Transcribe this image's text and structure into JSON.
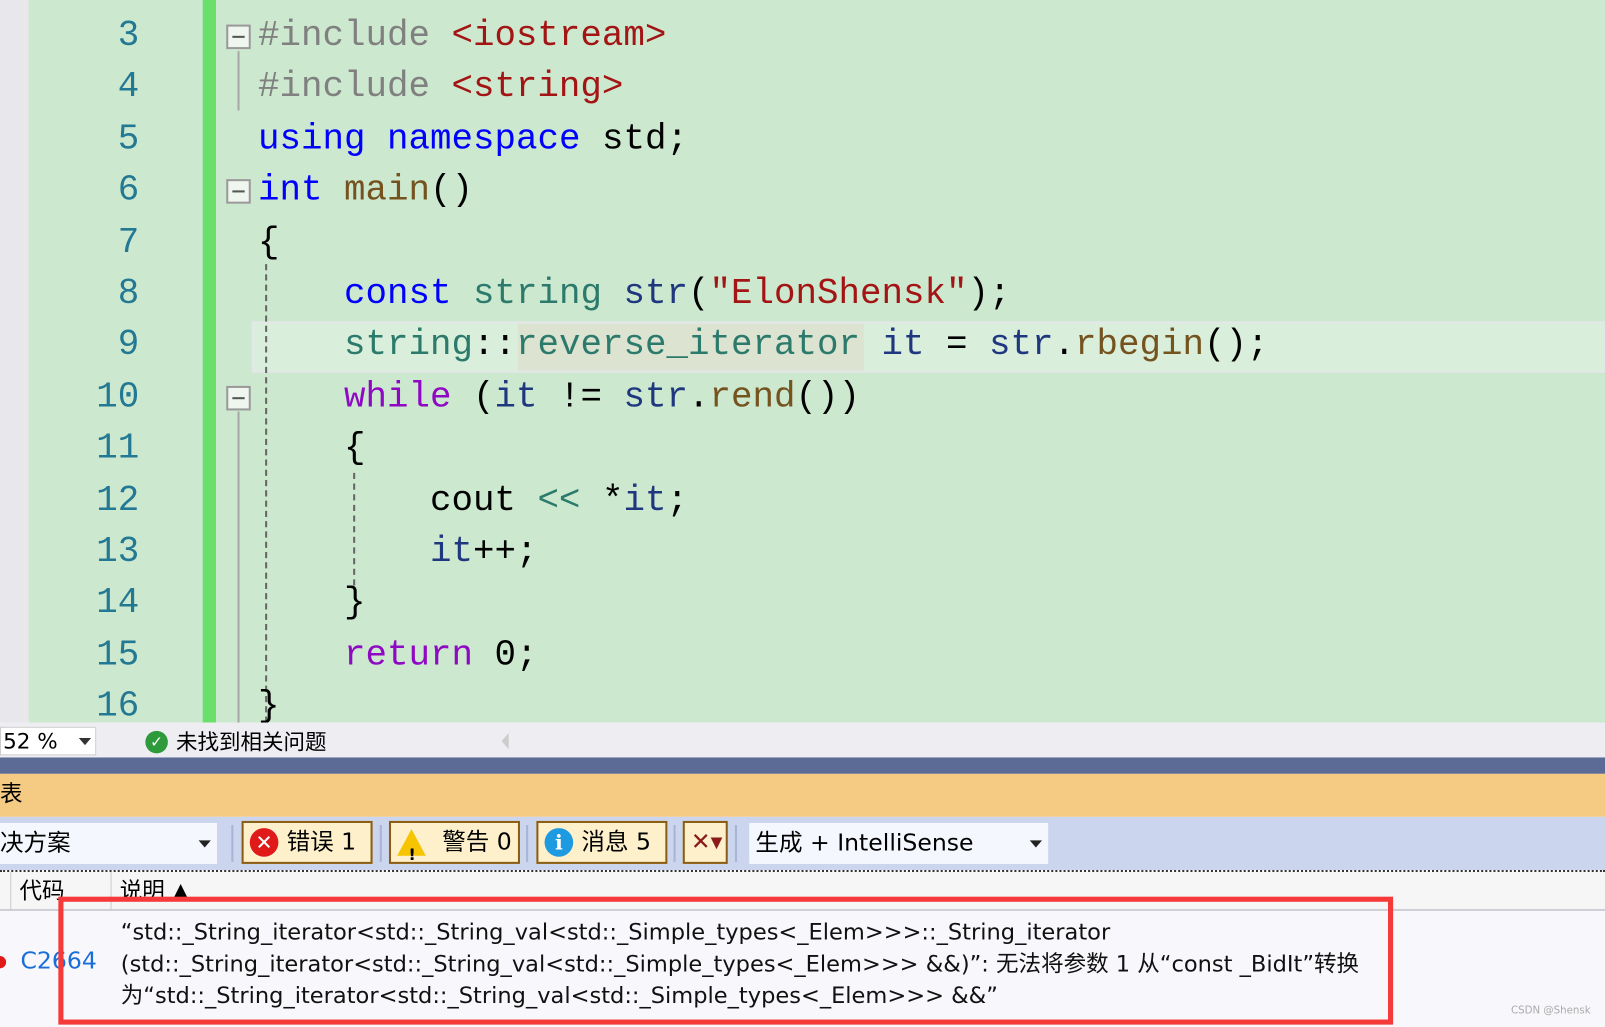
{
  "editor": {
    "lines": [
      {
        "num": "3",
        "tokens": [
          [
            "#include ",
            "pp"
          ],
          [
            "<iostream>",
            "str"
          ]
        ]
      },
      {
        "num": "4",
        "tokens": [
          [
            "#include ",
            "pp"
          ],
          [
            "<string>",
            "str"
          ]
        ]
      },
      {
        "num": "5",
        "tokens": [
          [
            "using",
            "kw"
          ],
          [
            " ",
            "plain"
          ],
          [
            "namespace",
            "kw"
          ],
          [
            " std;",
            "plain"
          ]
        ]
      },
      {
        "num": "6",
        "tokens": [
          [
            "int",
            "kw"
          ],
          [
            " ",
            "plain"
          ],
          [
            "main",
            "fn"
          ],
          [
            "()",
            "plain"
          ]
        ]
      },
      {
        "num": "7",
        "tokens": [
          [
            "{",
            "plain"
          ]
        ]
      },
      {
        "num": "8",
        "tokens": [
          [
            "    ",
            "plain"
          ],
          [
            "const",
            "kw"
          ],
          [
            " ",
            "plain"
          ],
          [
            "string",
            "ty"
          ],
          [
            " ",
            "plain"
          ],
          [
            "str",
            "var"
          ],
          [
            "(",
            "plain"
          ],
          [
            "\"ElonShensk\"",
            "str"
          ],
          [
            ");",
            "plain"
          ]
        ]
      },
      {
        "num": "9",
        "tokens": [
          [
            "    ",
            "plain"
          ],
          [
            "string",
            "ty"
          ],
          [
            "::",
            "plain"
          ],
          [
            "reverse_iterator",
            "ty"
          ],
          [
            " ",
            "plain"
          ],
          [
            "it",
            "var"
          ],
          [
            " = ",
            "plain"
          ],
          [
            "str",
            "var"
          ],
          [
            ".",
            "plain"
          ],
          [
            "rbegin",
            "fn"
          ],
          [
            "();",
            "plain"
          ]
        ]
      },
      {
        "num": "10",
        "tokens": [
          [
            "    ",
            "plain"
          ],
          [
            "while",
            "ctl"
          ],
          [
            " (",
            "plain"
          ],
          [
            "it",
            "var"
          ],
          [
            " != ",
            "plain"
          ],
          [
            "str",
            "var"
          ],
          [
            ".",
            "plain"
          ],
          [
            "rend",
            "fn"
          ],
          [
            "())",
            "plain"
          ]
        ]
      },
      {
        "num": "11",
        "tokens": [
          [
            "    {",
            "plain"
          ]
        ]
      },
      {
        "num": "12",
        "tokens": [
          [
            "        cout ",
            "plain"
          ],
          [
            "<<",
            "ty"
          ],
          [
            " ",
            "plain"
          ],
          [
            "*",
            "plain"
          ],
          [
            "it",
            "var"
          ],
          [
            ";",
            "plain"
          ]
        ]
      },
      {
        "num": "13",
        "tokens": [
          [
            "        ",
            "plain"
          ],
          [
            "it",
            "var"
          ],
          [
            "++;",
            "plain"
          ]
        ]
      },
      {
        "num": "14",
        "tokens": [
          [
            "    }",
            "plain"
          ]
        ]
      },
      {
        "num": "15",
        "tokens": [
          [
            "    ",
            "plain"
          ],
          [
            "return",
            "ctl"
          ],
          [
            " 0;",
            "plain"
          ]
        ]
      },
      {
        "num": "16",
        "tokens": [
          [
            "}",
            "plain"
          ]
        ]
      }
    ]
  },
  "status": {
    "zoom": "52 %",
    "message": "未找到相关问题"
  },
  "panel": {
    "title": "表",
    "scope": "决方案",
    "errors_label": "错误 1",
    "warnings_label": "警告 0",
    "messages_label": "消息 5",
    "build_filter": "生成 + IntelliSense",
    "columns": {
      "code": "代码",
      "description": "说明 ▲"
    },
    "rows": [
      {
        "code": "C2664",
        "description": "“std::_String_iterator<std::_String_val<std::_Simple_types<_Elem>>>::_String_iterator (std::_String_iterator<std::_String_val<std::_Simple_types<_Elem>>> &&)”: 无法将参数 1 从“const _BidIt”转换为“std::_String_iterator<std::_String_val<std::_Simple_types<_Elem>>> &&”"
      }
    ]
  },
  "watermark": "CSDN @Shensk",
  "colors": {
    "editor_bg": "#cce8cf",
    "keyword": "#0000ff",
    "type": "#2b7a6b",
    "string": "#a31515",
    "highlight": "#f63a3a"
  }
}
